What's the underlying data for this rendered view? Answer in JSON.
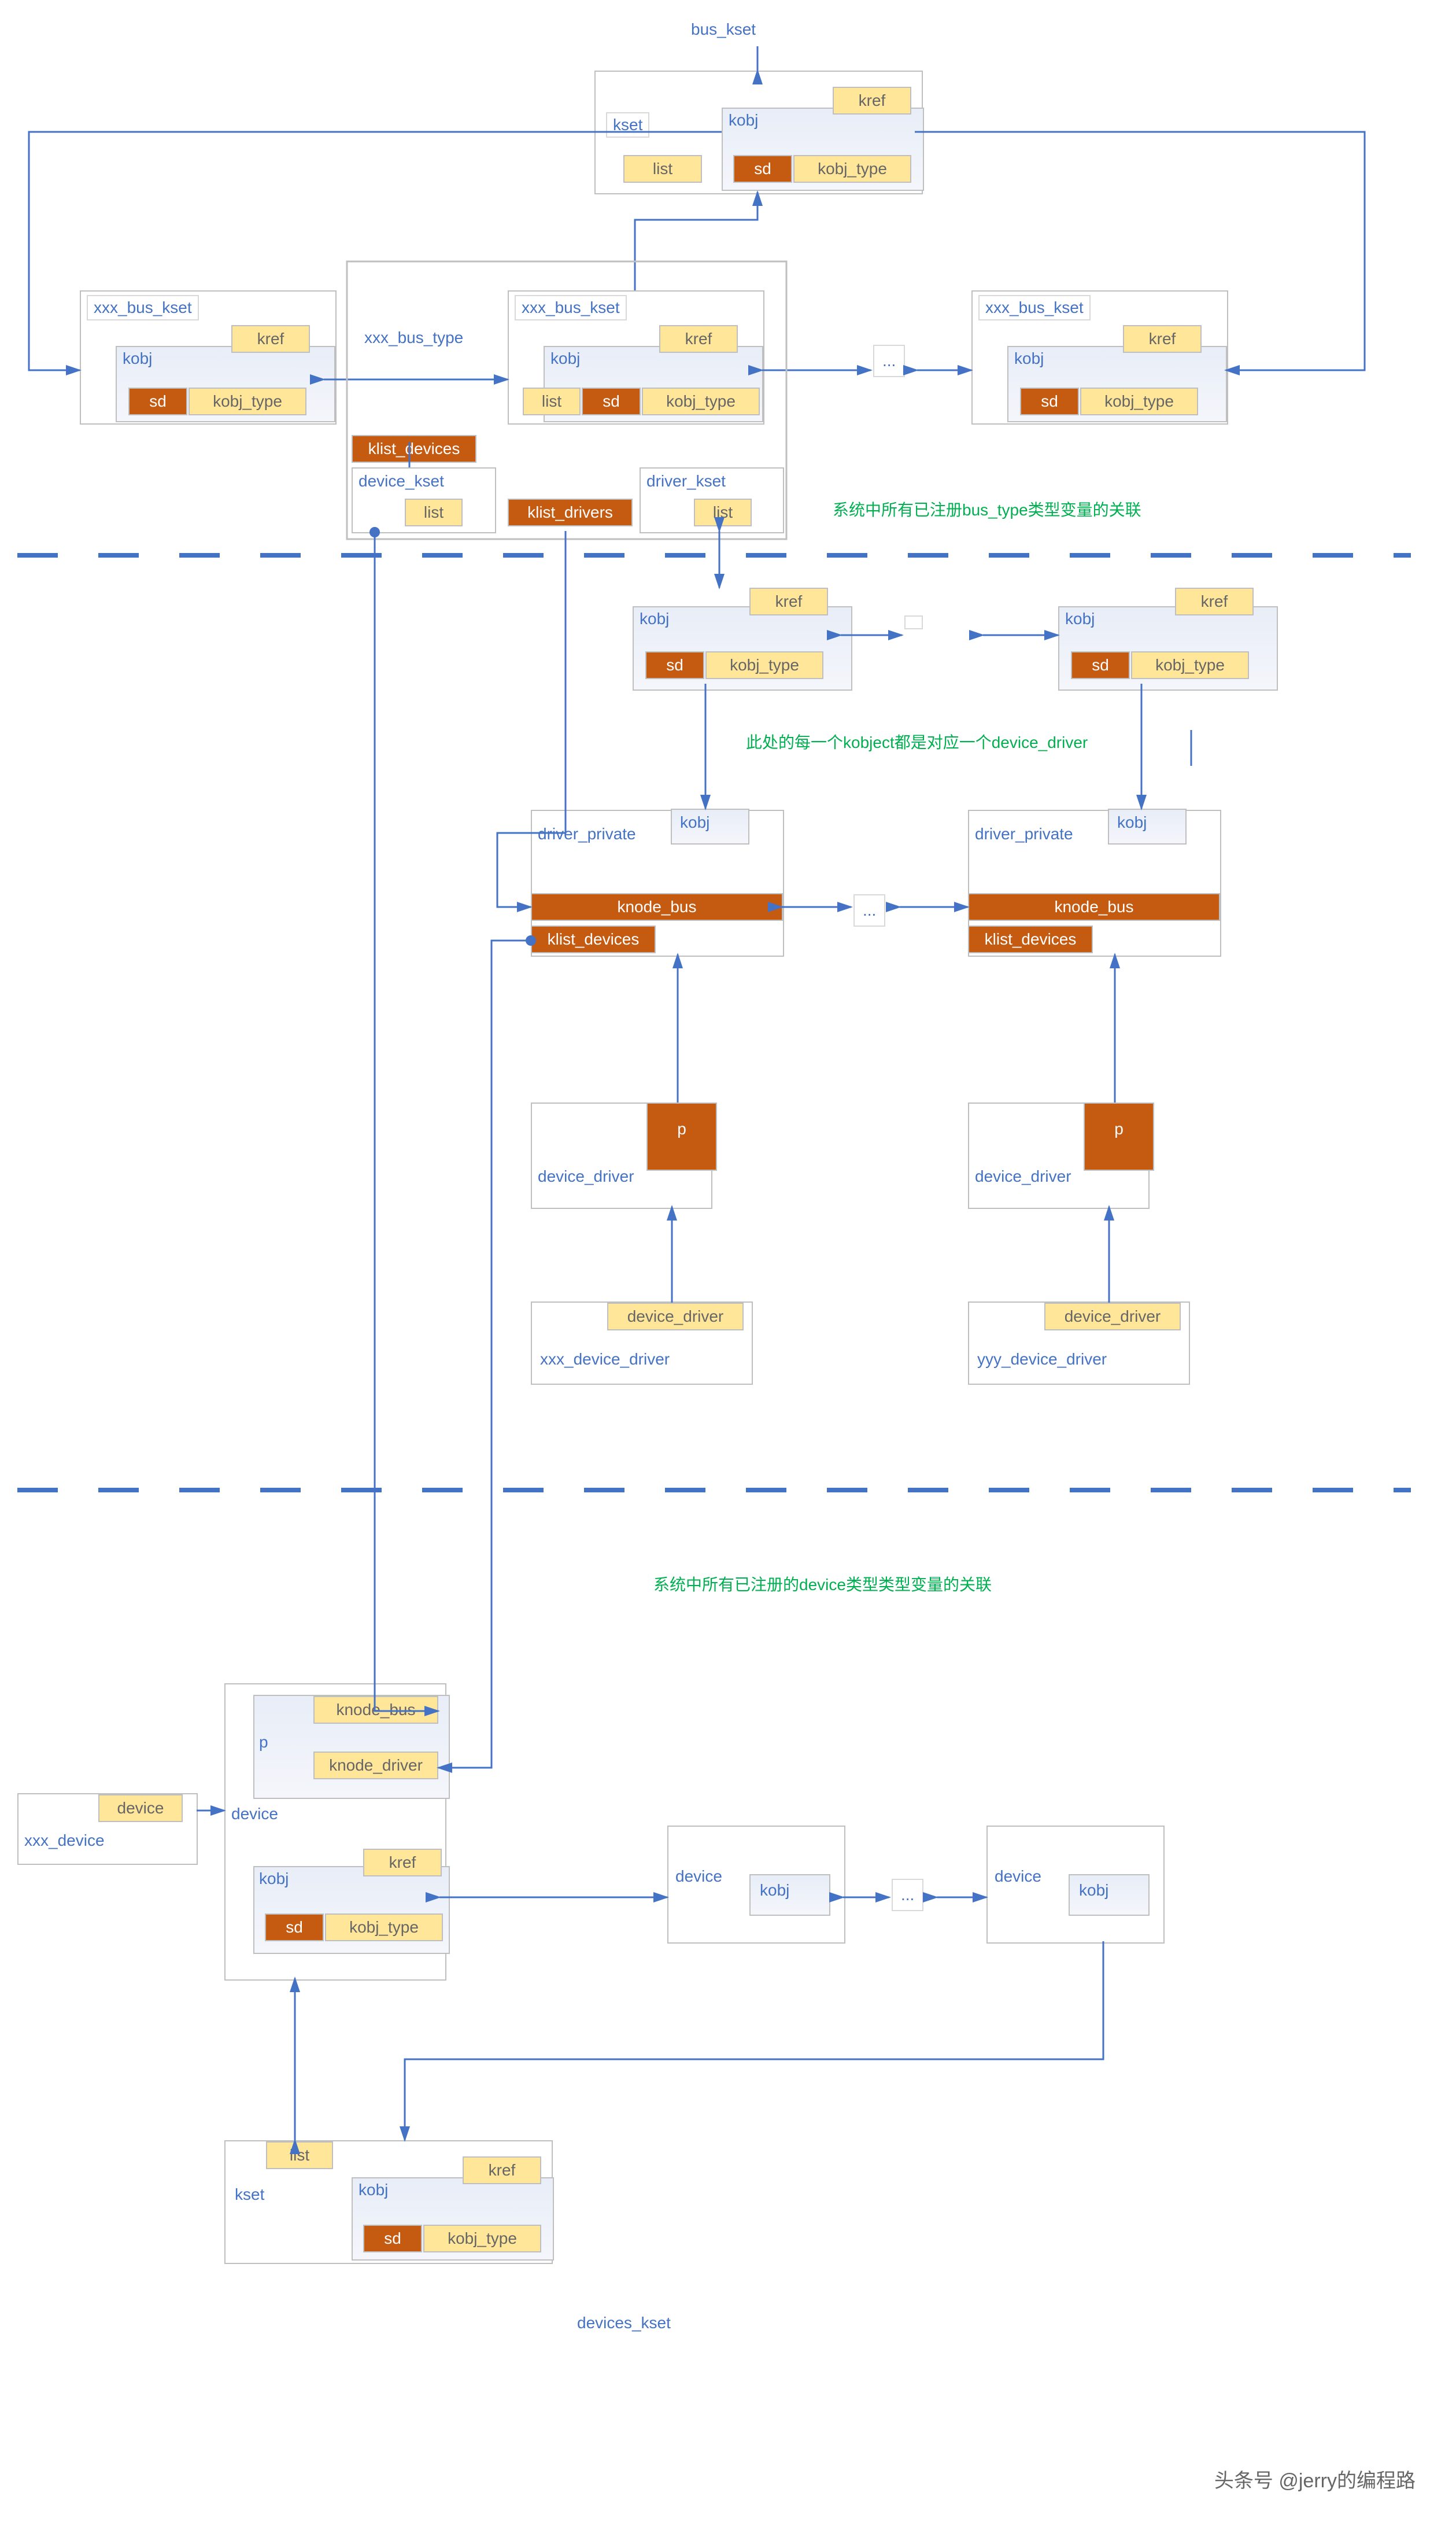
{
  "titles": {
    "bus_kset": "bus_kset",
    "devices_kset": "devices_kset",
    "xxx_bus_type": "xxx_bus_type"
  },
  "green": {
    "a": "系统中所有已注册bus_type类型变量的关联",
    "b": "此处的每一个kobject都是对应一个device_driver",
    "c": "系统中所有已注册的device类型类型变量的关联"
  },
  "labels": {
    "kset": "kset",
    "kobj": "kobj",
    "kref": "kref",
    "list": "list",
    "sd": "sd",
    "kobj_type": "kobj_type",
    "xxx_bus_kset": "xxx_bus_kset",
    "klist_devices": "klist_devices",
    "klist_drivers": "klist_drivers",
    "device_kset": "device_kset",
    "driver_kset": "driver_kset",
    "driver_private": "driver_private",
    "knode_bus": "knode_bus",
    "p": "p",
    "device_driver": "device_driver",
    "xxx_device_driver": "xxx_device_driver",
    "yyy_device_driver": "yyy_device_driver",
    "knode_driver": "knode_driver",
    "device": "device",
    "xxx_device": "xxx_device",
    "Kobj...": "Kobj ...",
    "dots": "..."
  },
  "watermark": "头条号 @jerry的编程路"
}
